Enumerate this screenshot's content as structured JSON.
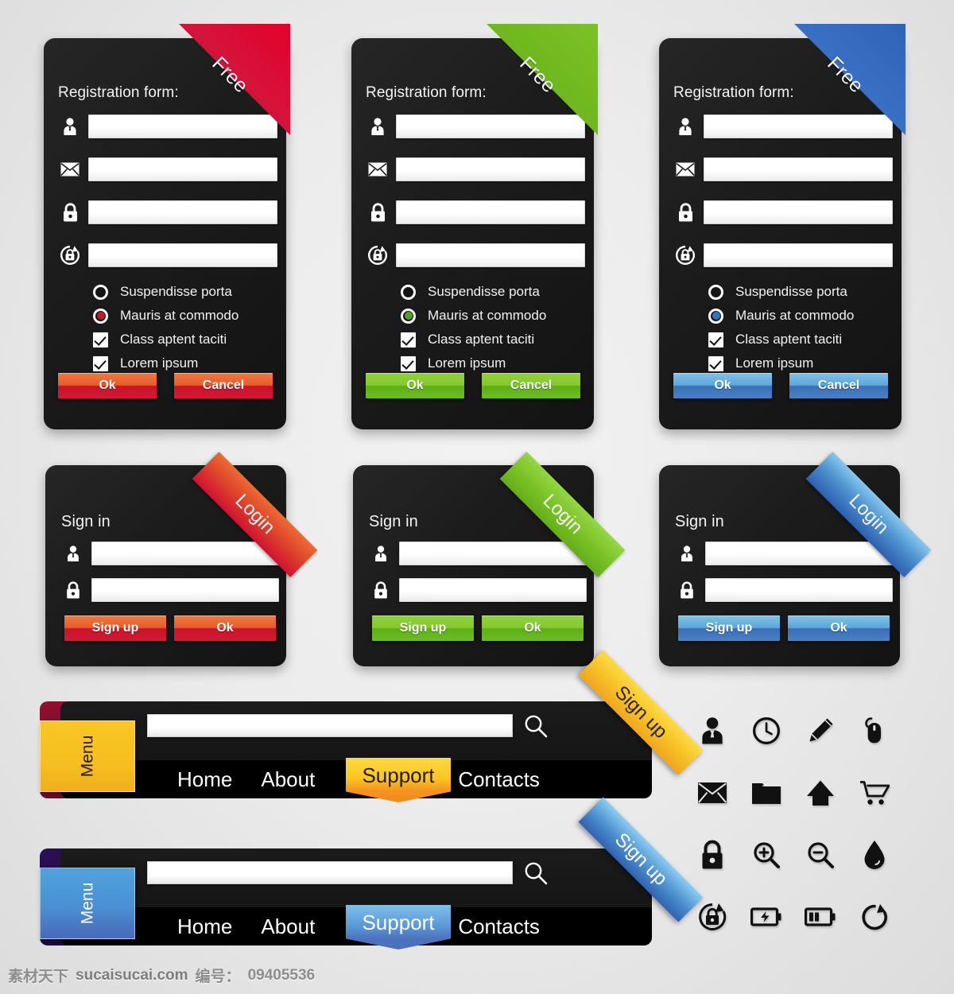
{
  "theme": {
    "red": "#d5143b",
    "green": "#7cc026",
    "blue": "#3a70c4",
    "yellow": "#f9c623",
    "panel_bg": "#1c1c1c",
    "page_bg": "#ececec"
  },
  "registration_forms": [
    {
      "ribbon": "Free",
      "title": "Registration form:",
      "color": "red",
      "fields": [
        {
          "icon": "user-icon",
          "value": "",
          "placeholder": ""
        },
        {
          "icon": "envelope-icon",
          "value": "",
          "placeholder": ""
        },
        {
          "icon": "lock-icon",
          "value": "",
          "placeholder": ""
        },
        {
          "icon": "lock-refresh-icon",
          "value": "",
          "placeholder": ""
        }
      ],
      "options": [
        {
          "type": "radio",
          "label": "Suspendisse porta",
          "checked": false
        },
        {
          "type": "radio",
          "label": "Mauris at commodo",
          "checked": true
        },
        {
          "type": "checkbox",
          "label": "Class aptent taciti",
          "checked": true
        },
        {
          "type": "checkbox",
          "label": "Lorem ipsum",
          "checked": true
        }
      ],
      "buttons": [
        "Ok",
        "Cancel"
      ]
    },
    {
      "ribbon": "Free",
      "title": "Registration form:",
      "color": "green",
      "fields": [
        {
          "icon": "user-icon",
          "value": "",
          "placeholder": ""
        },
        {
          "icon": "envelope-icon",
          "value": "",
          "placeholder": ""
        },
        {
          "icon": "lock-icon",
          "value": "",
          "placeholder": ""
        },
        {
          "icon": "lock-refresh-icon",
          "value": "",
          "placeholder": ""
        }
      ],
      "options": [
        {
          "type": "radio",
          "label": "Suspendisse porta",
          "checked": false
        },
        {
          "type": "radio",
          "label": "Mauris at commodo",
          "checked": true
        },
        {
          "type": "checkbox",
          "label": "Class aptent taciti",
          "checked": true
        },
        {
          "type": "checkbox",
          "label": "Lorem ipsum",
          "checked": true
        }
      ],
      "buttons": [
        "Ok",
        "Cancel"
      ]
    },
    {
      "ribbon": "Free",
      "title": "Registration form:",
      "color": "blue",
      "fields": [
        {
          "icon": "user-icon",
          "value": "",
          "placeholder": ""
        },
        {
          "icon": "envelope-icon",
          "value": "",
          "placeholder": ""
        },
        {
          "icon": "lock-icon",
          "value": "",
          "placeholder": ""
        },
        {
          "icon": "lock-refresh-icon",
          "value": "",
          "placeholder": ""
        }
      ],
      "options": [
        {
          "type": "radio",
          "label": "Suspendisse porta",
          "checked": false
        },
        {
          "type": "radio",
          "label": "Mauris at commodo",
          "checked": true
        },
        {
          "type": "checkbox",
          "label": "Class aptent taciti",
          "checked": true
        },
        {
          "type": "checkbox",
          "label": "Lorem ipsum",
          "checked": true
        }
      ],
      "buttons": [
        "Ok",
        "Cancel"
      ]
    }
  ],
  "signin_forms": [
    {
      "ribbon": "Login",
      "title": "Sign in",
      "color": "red",
      "fields": [
        {
          "icon": "user-icon",
          "value": ""
        },
        {
          "icon": "lock-icon",
          "value": ""
        }
      ],
      "buttons": [
        "Sign up",
        "Ok"
      ]
    },
    {
      "ribbon": "Login",
      "title": "Sign in",
      "color": "green",
      "fields": [
        {
          "icon": "user-icon",
          "value": ""
        },
        {
          "icon": "lock-icon",
          "value": ""
        }
      ],
      "buttons": [
        "Sign up",
        "Ok"
      ]
    },
    {
      "ribbon": "Login",
      "title": "Sign in",
      "color": "blue",
      "fields": [
        {
          "icon": "user-icon",
          "value": ""
        },
        {
          "icon": "lock-icon",
          "value": ""
        }
      ],
      "buttons": [
        "Sign up",
        "Ok"
      ]
    }
  ],
  "navbars": [
    {
      "color": "yellow",
      "menu_label": "Menu",
      "search_value": "",
      "search_placeholder": "",
      "search_icon": "magnifier-icon",
      "ribbon": "Sign up",
      "links": [
        "Home",
        "About",
        "Support",
        "Contacts"
      ],
      "active_link": "Support"
    },
    {
      "color": "blue",
      "menu_label": "Menu",
      "search_value": "",
      "search_placeholder": "",
      "search_icon": "magnifier-icon",
      "ribbon": "Sign up",
      "links": [
        "Home",
        "About",
        "Support",
        "Contacts"
      ],
      "active_link": "Support"
    }
  ],
  "icon_grid": [
    "user-icon",
    "clock-icon",
    "pencil-icon",
    "mouse-icon",
    "envelope-icon",
    "folder-icon",
    "home-icon",
    "cart-icon",
    "lock-icon",
    "zoom-in-icon",
    "zoom-out-icon",
    "droplet-icon",
    "lock-refresh-icon",
    "battery-charging-icon",
    "battery-half-icon",
    "refresh-icon"
  ],
  "watermark": {
    "brand": "素材天下",
    "site": "sucaisucai.com",
    "id_label": "编号：",
    "id_value": "09405536"
  }
}
